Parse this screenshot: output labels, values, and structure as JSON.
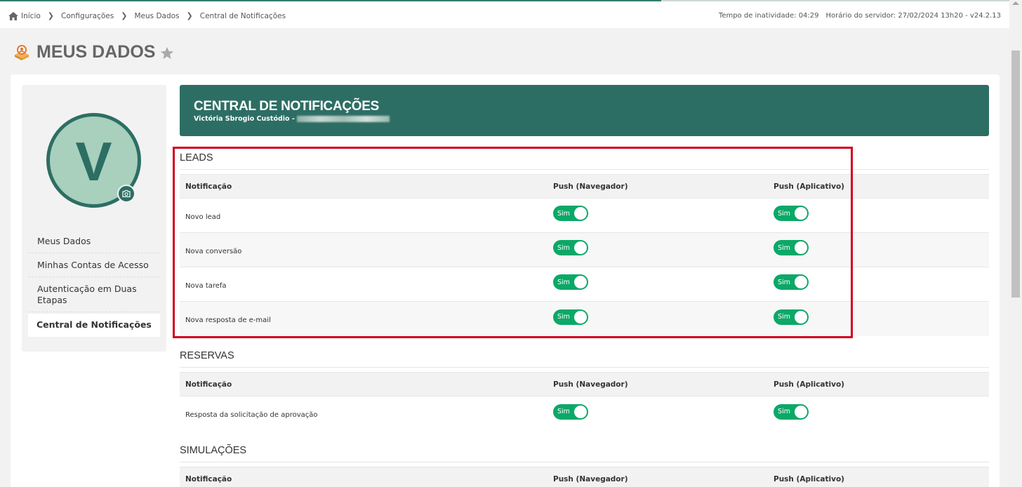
{
  "breadcrumb": {
    "items": [
      "Início",
      "Configurações",
      "Meus Dados",
      "Central de Notificações"
    ]
  },
  "status": {
    "inactivity": "Tempo de inatividade: 04:29",
    "server": "Horário do servidor: 27/02/2024 13h20 - v24.2.13"
  },
  "page": {
    "title": "MEUS DADOS"
  },
  "profile": {
    "initial": "V"
  },
  "sidebar": {
    "items": [
      {
        "label": "Meus Dados"
      },
      {
        "label": "Minhas Contas de Acesso"
      },
      {
        "label": "Autenticação em Duas Etapas"
      },
      {
        "label": "Central de Notificações"
      }
    ],
    "active_index": 3
  },
  "banner": {
    "title": "CENTRAL DE NOTIFICAÇÕES",
    "subtitle": "Victória Sbrogio Custódio -"
  },
  "table_headers": {
    "notification": "Notificação",
    "push_browser": "Push (Navegador)",
    "push_app": "Push (Aplicativo)"
  },
  "toggle_on_label": "Sim",
  "sections": [
    {
      "title": "LEADS",
      "rows": [
        {
          "label": "Novo lead",
          "browser": "Sim",
          "app": "Sim"
        },
        {
          "label": "Nova conversão",
          "browser": "Sim",
          "app": "Sim"
        },
        {
          "label": "Nova tarefa",
          "browser": "Sim",
          "app": "Sim"
        },
        {
          "label": "Nova resposta de e-mail",
          "browser": "Sim",
          "app": "Sim"
        }
      ]
    },
    {
      "title": "RESERVAS",
      "rows": [
        {
          "label": "Resposta da solicitação de aprovação",
          "browser": "Sim",
          "app": "Sim"
        }
      ]
    },
    {
      "title": "SIMULAÇÕES",
      "rows": []
    }
  ],
  "colors": {
    "brand": "#2d6e64",
    "toggle_on": "#0ca868",
    "highlight": "#d0021b"
  }
}
